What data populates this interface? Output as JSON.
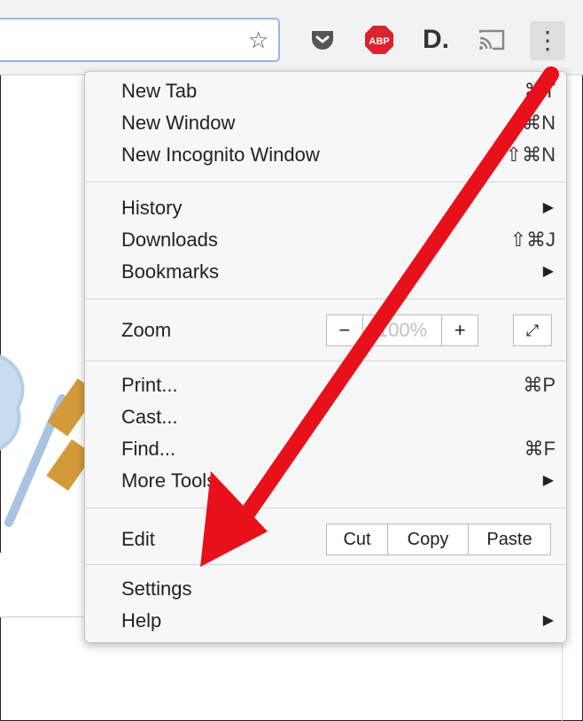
{
  "toolbar": {
    "extensions": {
      "abp_label": "ABP",
      "d_label": "D."
    },
    "menu_button_glyph": "⋮"
  },
  "menu": {
    "new_tab": {
      "label": "New Tab",
      "shortcut": "⌘T"
    },
    "new_window": {
      "label": "New Window",
      "shortcut": "⌘N"
    },
    "new_incognito": {
      "label": "New Incognito Window",
      "shortcut": "⇧⌘N"
    },
    "history": {
      "label": "History"
    },
    "downloads": {
      "label": "Downloads",
      "shortcut": "⇧⌘J"
    },
    "bookmarks": {
      "label": "Bookmarks"
    },
    "zoom": {
      "label": "Zoom",
      "minus": "−",
      "value": "100%",
      "plus": "+"
    },
    "print": {
      "label": "Print...",
      "shortcut": "⌘P"
    },
    "cast": {
      "label": "Cast..."
    },
    "find": {
      "label": "Find...",
      "shortcut": "⌘F"
    },
    "more_tools": {
      "label": "More Tools"
    },
    "edit": {
      "label": "Edit",
      "cut": "Cut",
      "copy": "Copy",
      "paste": "Paste"
    },
    "settings": {
      "label": "Settings"
    },
    "help": {
      "label": "Help"
    }
  },
  "icons": {
    "star": "bookmark-star-icon",
    "pocket": "pocket-icon",
    "abp": "adblock-plus-icon",
    "d": "d-extension-icon",
    "cast": "cast-icon",
    "menu": "kebab-menu-icon",
    "submenu": "submenu-arrow-icon",
    "fullscreen": "fullscreen-icon",
    "mic": "microphone-icon"
  },
  "colors": {
    "annotation_arrow": "#e8101b",
    "omnibox_border": "#9ab3e8"
  }
}
